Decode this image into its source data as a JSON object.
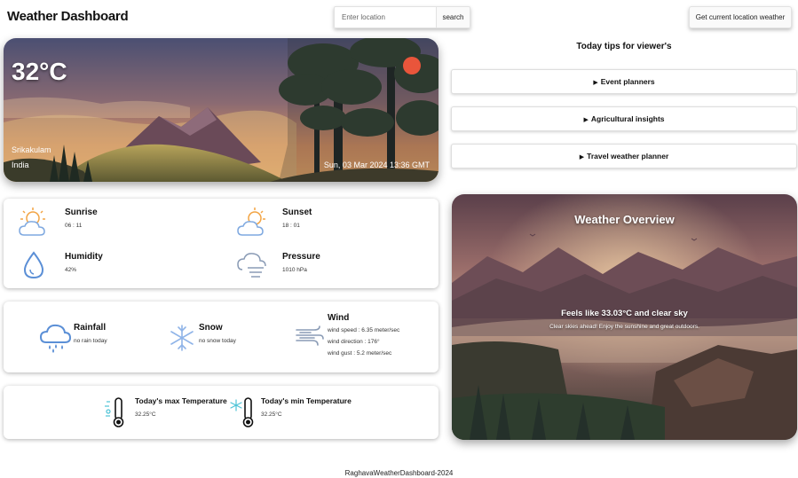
{
  "header": {
    "title": "Weather Dashboard",
    "search_placeholder": "Enter location",
    "search_label": "search",
    "geo_label": "Get current location weather"
  },
  "hero": {
    "temperature": "32°C",
    "city": "Srikakulam",
    "country": "India",
    "datetime": "Sun, 03 Mar 2024 13:36 GMT"
  },
  "tips": {
    "title": "Today tips for viewer's",
    "items": [
      {
        "label": "Event planners"
      },
      {
        "label": "Agricultural insights"
      },
      {
        "label": "Travel weather planner"
      }
    ]
  },
  "sun_card": {
    "sunrise": {
      "title": "Sunrise",
      "value": "06 : 11",
      "icon": "sunrise-icon"
    },
    "sunset": {
      "title": "Sunset",
      "value": "18 : 01",
      "icon": "sunset-icon"
    },
    "humidity": {
      "title": "Humidity",
      "value": "42%",
      "icon": "droplet-icon"
    },
    "pressure": {
      "title": "Pressure",
      "value": "1010 hPa",
      "icon": "pressure-icon"
    }
  },
  "precip_card": {
    "rainfall": {
      "title": "Rainfall",
      "value": "no rain today",
      "icon": "rain-cloud-icon"
    },
    "snow": {
      "title": "Snow",
      "value": "no snow today",
      "icon": "snowflake-icon"
    },
    "wind": {
      "title": "Wind",
      "speed": "wind speed : 6.35 meter/sec",
      "direction": "wind direction : 176°",
      "gust": "wind gust : 5.2 meter/sec",
      "icon": "wind-icon"
    }
  },
  "temp_card": {
    "max": {
      "title": "Today's max Temperature",
      "value": "32.25°C",
      "icon": "thermometer-hot-icon"
    },
    "min": {
      "title": "Today's min Temperature",
      "value": "32.25°C",
      "icon": "thermometer-cold-icon"
    }
  },
  "overview": {
    "title": "Weather Overview",
    "feels": "Feels like 33.03°C and clear sky",
    "description": "Clear skies ahead! Enjoy the sunshine and great outdoors."
  },
  "footer": {
    "text": "RaghavaWeatherDashboard-2024"
  },
  "colors": {
    "sun_dot": "#e9553b",
    "icon_blue": "#5b8fd6",
    "icon_orange": "#f2a444"
  }
}
